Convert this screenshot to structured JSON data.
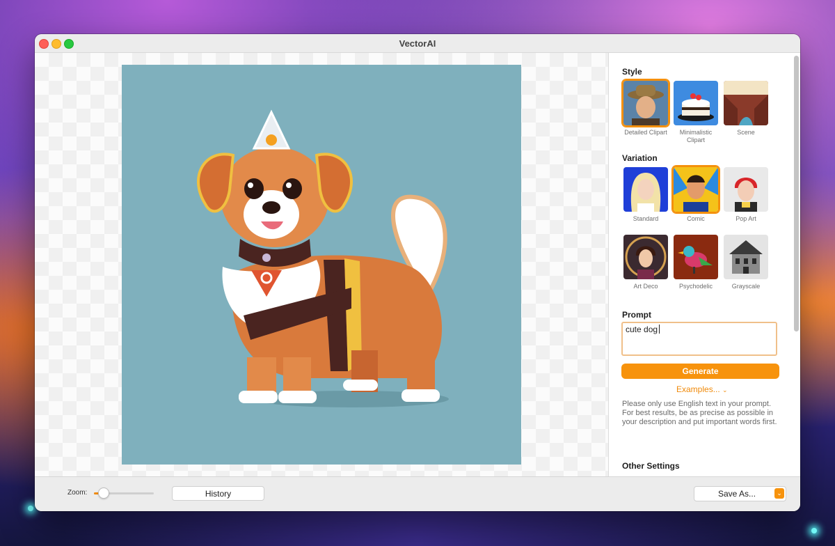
{
  "window": {
    "title": "VectorAI"
  },
  "sidebar": {
    "style": {
      "heading": "Style",
      "items": [
        {
          "label": "Detailed Clipart",
          "selected": true,
          "icon": "cowboy-portrait-icon"
        },
        {
          "label": "Minimalistic Clipart",
          "selected": false,
          "icon": "cake-icon"
        },
        {
          "label": "Scene",
          "selected": false,
          "icon": "canyon-scene-icon"
        }
      ]
    },
    "variation": {
      "heading": "Variation",
      "items": [
        {
          "label": "Standard",
          "selected": false,
          "icon": "blonde-portrait-icon"
        },
        {
          "label": "Comic",
          "selected": true,
          "icon": "comic-hero-icon"
        },
        {
          "label": "Pop Art",
          "selected": false,
          "icon": "pop-art-woman-icon"
        },
        {
          "label": "Art Deco",
          "selected": false,
          "icon": "art-deco-woman-icon"
        },
        {
          "label": "Psychodelic",
          "selected": false,
          "icon": "bird-icon"
        },
        {
          "label": "Grayscale",
          "selected": false,
          "icon": "house-icon"
        }
      ]
    },
    "prompt": {
      "heading": "Prompt",
      "value": "cute dog",
      "generate_label": "Generate",
      "examples_label": "Examples...",
      "hint": "Please only use English text in your prompt. For best results, be as precise as possible in your description and put important words first."
    },
    "other_settings": {
      "heading": "Other Settings"
    }
  },
  "bottombar": {
    "zoom_label": "Zoom:",
    "zoom_level": 0.15,
    "history_label": "History",
    "save_label": "Save As..."
  },
  "colors": {
    "accent": "#f7930d",
    "image_background": "#7fb0bd"
  }
}
